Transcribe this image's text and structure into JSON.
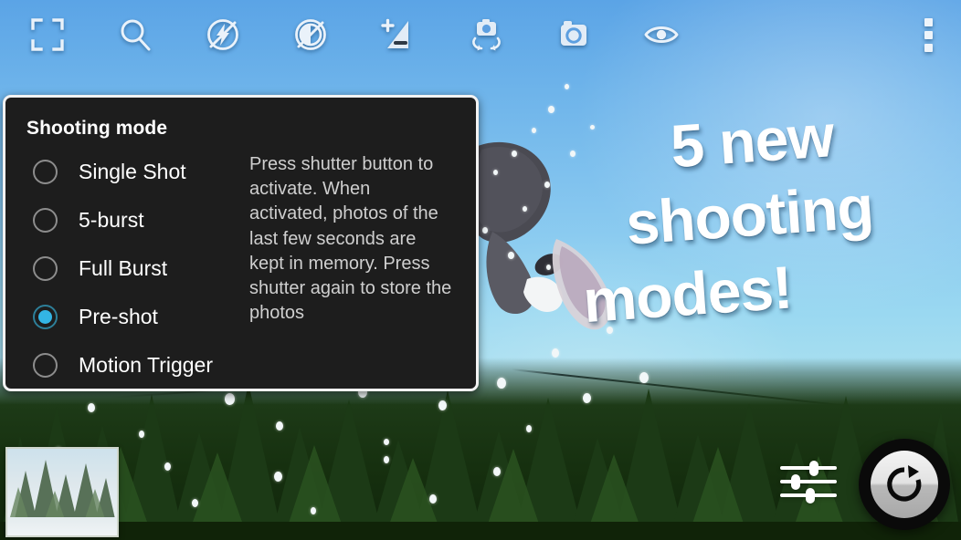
{
  "app": {
    "screen_name": "camera-viewfinder",
    "scene_description": "Snowboarder jumping against blue sky over pine trees"
  },
  "toolbar": {
    "items": [
      {
        "name": "focus-frame-icon",
        "label": "Focus mode"
      },
      {
        "name": "zoom-icon",
        "label": "Zoom"
      },
      {
        "name": "flash-off-icon",
        "label": "Flash off"
      },
      {
        "name": "hdr-off-icon",
        "label": "HDR off"
      },
      {
        "name": "exposure-compensation-icon",
        "label": "Exposure compensation"
      },
      {
        "name": "switch-camera-icon",
        "label": "Switch camera"
      },
      {
        "name": "camera-mode-icon",
        "label": "Camera mode"
      },
      {
        "name": "preview-eye-icon",
        "label": "Preview"
      }
    ],
    "overflow_label": "More options"
  },
  "dialog": {
    "title": "Shooting mode",
    "options": [
      {
        "label": "Single Shot",
        "selected": false
      },
      {
        "label": "5-burst",
        "selected": false
      },
      {
        "label": "Full Burst",
        "selected": false
      },
      {
        "label": "Pre-shot",
        "selected": true
      },
      {
        "label": "Motion Trigger",
        "selected": false
      }
    ],
    "description": "Press shutter button to activate. When activated, photos of the last few seconds are kept in memory. Press shutter again to store the photos",
    "accent_color": "#33b5e5",
    "background_color": "#1d1d1d",
    "border_color": "#f2f2f2"
  },
  "promo": {
    "line1": "5 new",
    "line2": "shooting",
    "line3": "modes!",
    "color": "#ffffff"
  },
  "bottom_controls": {
    "thumbnail_label": "Last photo thumbnail",
    "settings_label": "Settings sliders",
    "shutter_label": "Shutter",
    "shutter_icon": "rotate-refresh-icon"
  }
}
